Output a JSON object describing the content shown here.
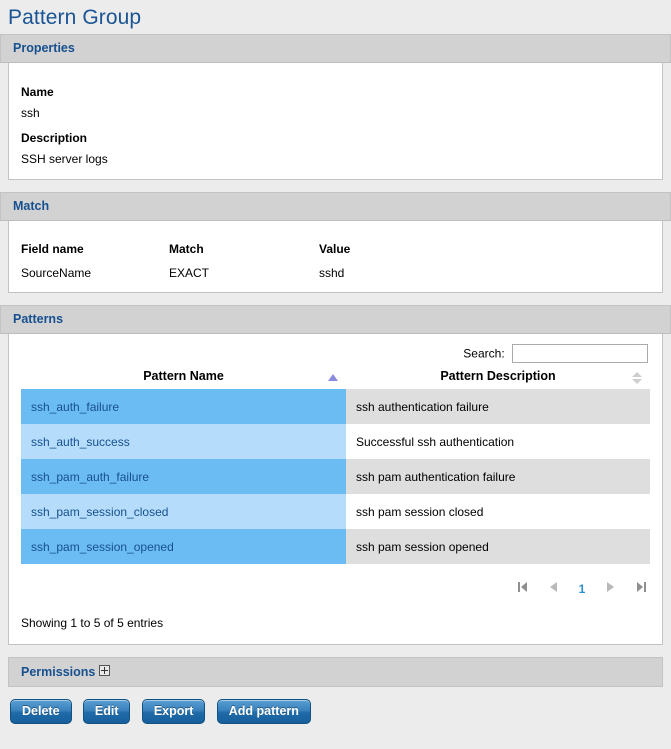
{
  "page": {
    "title": "Pattern Group"
  },
  "properties": {
    "header": "Properties",
    "name_label": "Name",
    "name_value": "ssh",
    "description_label": "Description",
    "description_value": "SSH server logs"
  },
  "match": {
    "header": "Match",
    "columns": [
      "Field name",
      "Match",
      "Value"
    ],
    "rows": [
      {
        "field_name": "SourceName",
        "match": "EXACT",
        "value": "sshd"
      }
    ]
  },
  "patterns": {
    "header": "Patterns",
    "search_label": "Search:",
    "search_value": "",
    "search_placeholder": "",
    "columns": [
      {
        "label": "Pattern Name",
        "sort": "asc"
      },
      {
        "label": "Pattern Description",
        "sort": "none"
      }
    ],
    "rows": [
      {
        "name": "ssh_auth_failure",
        "description": "ssh authentication failure"
      },
      {
        "name": "ssh_auth_success",
        "description": "Successful ssh authentication"
      },
      {
        "name": "ssh_pam_auth_failure",
        "description": "ssh pam authentication failure"
      },
      {
        "name": "ssh_pam_session_closed",
        "description": "ssh pam session closed"
      },
      {
        "name": "ssh_pam_session_opened",
        "description": "ssh pam session opened"
      }
    ],
    "pagination": {
      "first_title": "First",
      "prev_title": "Previous",
      "current_page": "1",
      "next_title": "Next",
      "last_title": "Last"
    },
    "showing": "Showing 1 to 5 of 5 entries"
  },
  "permissions": {
    "header": "Permissions",
    "expand_icon": "expand-plus-icon"
  },
  "actions": {
    "delete": "Delete",
    "edit": "Edit",
    "export": "Export",
    "add_pattern": "Add pattern"
  },
  "colors": {
    "page_background": "#ececec",
    "title_blue": "#1a5494",
    "header_grey": "#d2d2d2",
    "header_text": "#17508f",
    "row_odd_blue": "#6bbcf2",
    "row_even_blue": "#b5ddfb",
    "row_odd_grey": "#dedede",
    "row_even_white": "#ffffff",
    "button_blue": "#1f6aa8",
    "pager_active": "#2a8fd4",
    "sort_active_arrow": "#8b8bdd"
  }
}
